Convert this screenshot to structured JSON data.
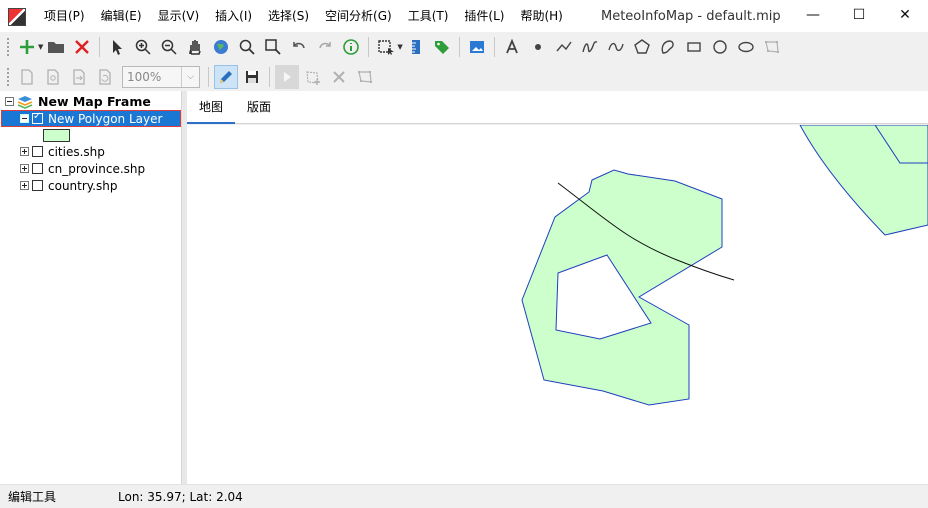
{
  "window": {
    "title": "MeteoInfoMap - default.mip",
    "controls": {
      "minimize": "—",
      "maximize": "☐",
      "close": "✕"
    }
  },
  "menu": [
    {
      "label": "项目(P)"
    },
    {
      "label": "编辑(E)"
    },
    {
      "label": "显示(V)"
    },
    {
      "label": "插入(I)"
    },
    {
      "label": "选择(S)"
    },
    {
      "label": "空间分析(G)"
    },
    {
      "label": "工具(T)"
    },
    {
      "label": "插件(L)"
    },
    {
      "label": "帮助(H)"
    }
  ],
  "toolbar2": {
    "zoom_value": "100%"
  },
  "tree": {
    "frame_label": "New Map Frame",
    "selected_layer": "New Polygon Layer",
    "layers": [
      {
        "label": "cities.shp"
      },
      {
        "label": "cn_province.shp"
      },
      {
        "label": "country.shp"
      }
    ]
  },
  "tabs": [
    {
      "label": "地图",
      "active": true
    },
    {
      "label": "版面",
      "active": false
    }
  ],
  "colors": {
    "polygon_fill": "#ccffcc",
    "polygon_stroke": "#1f3fbf",
    "selection": "#1a78d4",
    "selection_border": "#e03a3a"
  },
  "status": {
    "left": "编辑工具",
    "coords": "Lon: 35.97; Lat: 2.04"
  }
}
